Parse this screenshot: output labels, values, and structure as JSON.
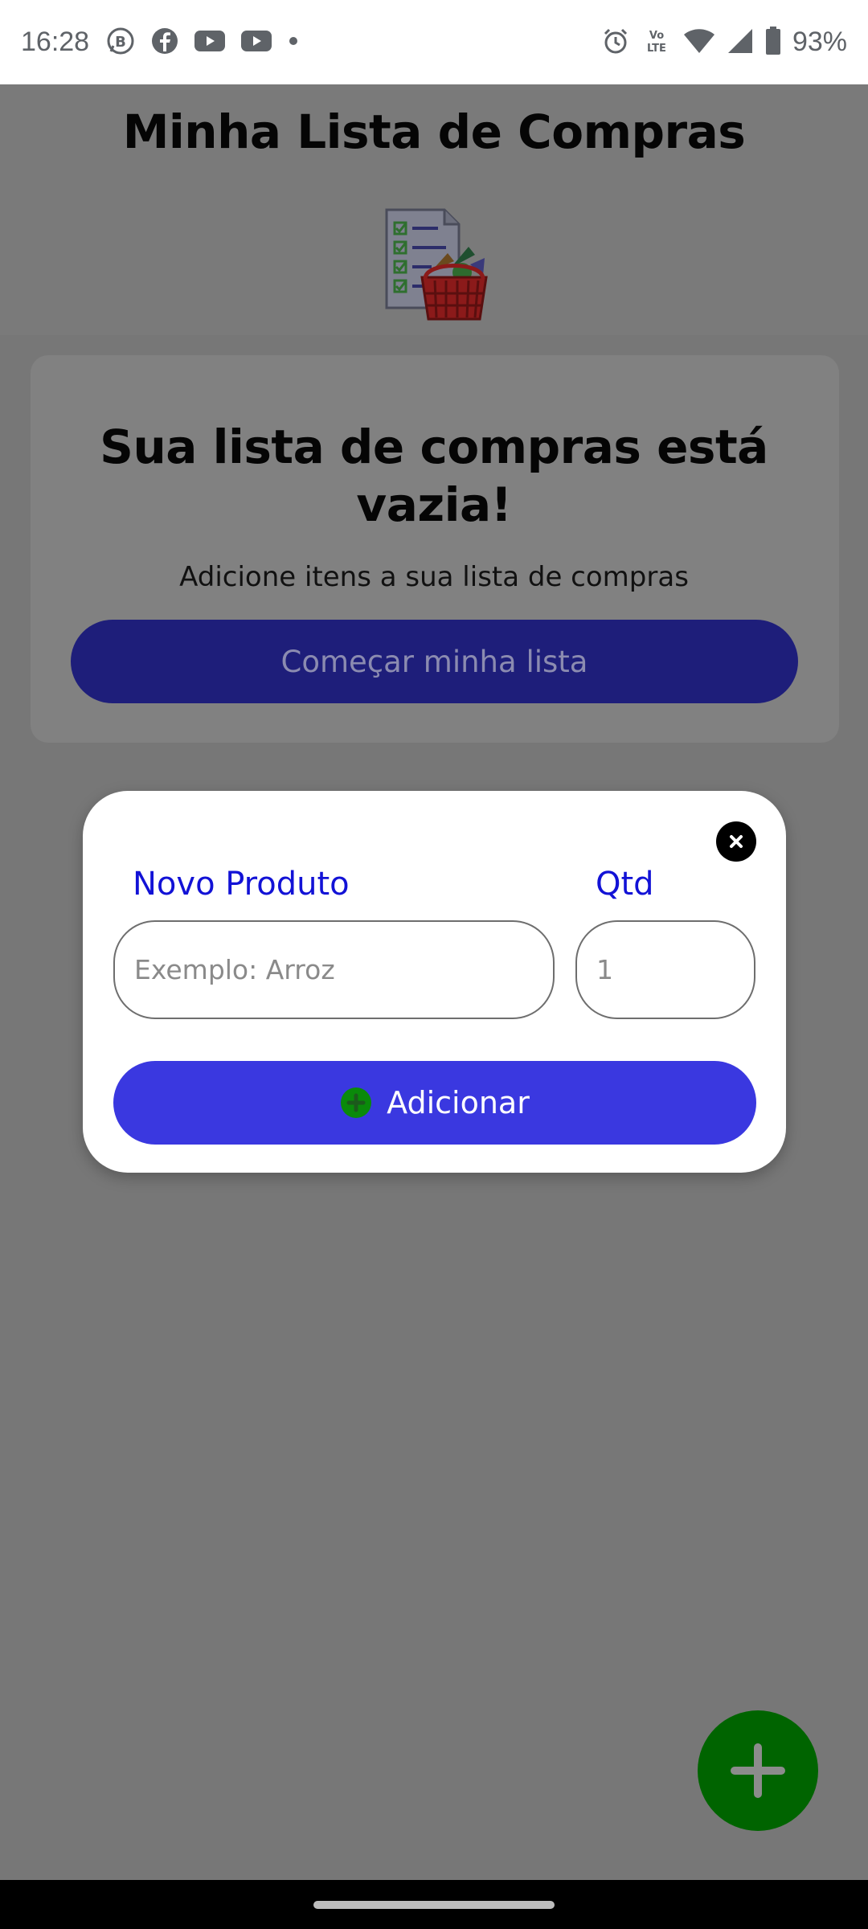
{
  "status_bar": {
    "time": "16:28",
    "battery": "93%",
    "left_icons": [
      "whatsapp-business-icon",
      "facebook-icon",
      "youtube-icon",
      "youtube-icon",
      "dot-icon"
    ],
    "right_icons": [
      "alarm-icon",
      "volte-icon",
      "wifi-icon",
      "signal-icon",
      "battery-icon"
    ],
    "volte_label": "Vo LTE"
  },
  "header": {
    "title": "Minha Lista de Compras",
    "image_icon": "shopping-list-basket-icon"
  },
  "empty_state": {
    "title": "Sua lista de compras está vazia!",
    "subtitle": "Adicione itens a sua lista de compras",
    "start_button": "Começar minha lista"
  },
  "modal": {
    "close_icon": "close-icon",
    "product_label": "Novo Produto",
    "product_placeholder": "Exemplo: Arroz",
    "product_value": "",
    "qty_label": "Qtd",
    "qty_placeholder": "1",
    "qty_value": "",
    "add_button": "Adicionar",
    "add_icon": "plus-circle-icon"
  },
  "fab": {
    "icon": "plus-icon"
  },
  "colors": {
    "overlay_bg": "#777777",
    "accent_blue": "#3a38e0",
    "label_blue": "#1212d6",
    "dim_button": "#1e1e7a",
    "fab_green": "#006400",
    "icon_green": "#0a8a0a"
  }
}
